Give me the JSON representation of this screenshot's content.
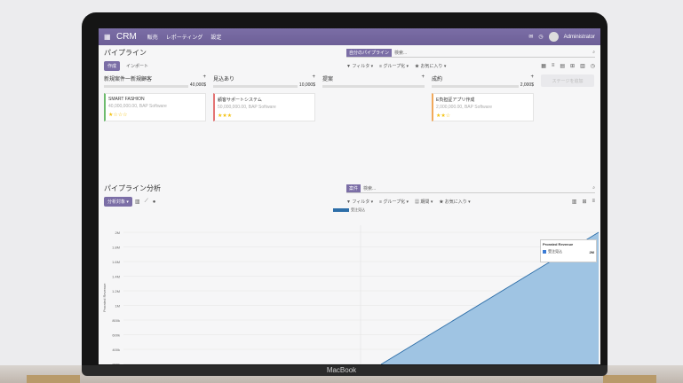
{
  "navbar": {
    "app": "CRM",
    "menu": [
      "販売",
      "レポーティング",
      "設定"
    ],
    "user": "Administrator"
  },
  "pipeline": {
    "title": "パイプライン",
    "create_label": "作成",
    "import_label": "インポート",
    "search_facet": "自分のパイプライン",
    "search_placeholder": "検索...",
    "tools": [
      "▼ フィルタ ▾",
      "≡ グループ化 ▾",
      "★ お気に入り ▾"
    ],
    "columns": [
      {
        "name": "新規案件一新規顧客",
        "amount": "40,000$",
        "cards": [
          {
            "title": "SMART FASHION",
            "meta": "40,000,000.00, BAP Software",
            "stars": "★☆☆☆",
            "color": "green"
          }
        ]
      },
      {
        "name": "見込あり",
        "amount": "10,000$",
        "cards": [
          {
            "title": "顧客サポートシステム",
            "meta": "50,000,000.00, BAP Software",
            "stars": "★★★",
            "color": "red"
          }
        ]
      },
      {
        "name": "提案",
        "amount": "",
        "cards": []
      },
      {
        "name": "成約",
        "amount": "2,000$",
        "cards": [
          {
            "title": "E負担証アプリ作成",
            "meta": "2,000,000.00, BAP Software",
            "stars": "★★☆",
            "color": "orange"
          }
        ]
      }
    ],
    "add_column": "ステージを追加"
  },
  "analysis": {
    "title": "パイプライン分析",
    "measures_label": "分析対象 ▾",
    "search_facet": "案件",
    "search_placeholder": "検索...",
    "tools": [
      "▼ フィルタ ▾",
      "≡ グループ化 ▾",
      "▦ 期間 ▾",
      "★ お気に入り ▾"
    ]
  },
  "chart_data": {
    "type": "area",
    "ylabel": "Prorated Revenue",
    "legend": [
      "受注見込"
    ],
    "y_ticks": [
      "2M",
      "1.8M",
      "1.6M",
      "1.4M",
      "1.2M",
      "1M",
      "800k",
      "600k",
      "400k",
      "200k"
    ],
    "series": [
      {
        "name": "受注見込",
        "values": [
          0,
          2000000
        ]
      }
    ],
    "tooltip": {
      "title": "Prorated Revenue",
      "label": "受注見込",
      "value": "2M"
    }
  },
  "macbook_label": "MacBook",
  "colors": {
    "accent": "#7b6ea6",
    "area": "#9fc4e3",
    "area_line": "#2d6ea8"
  }
}
